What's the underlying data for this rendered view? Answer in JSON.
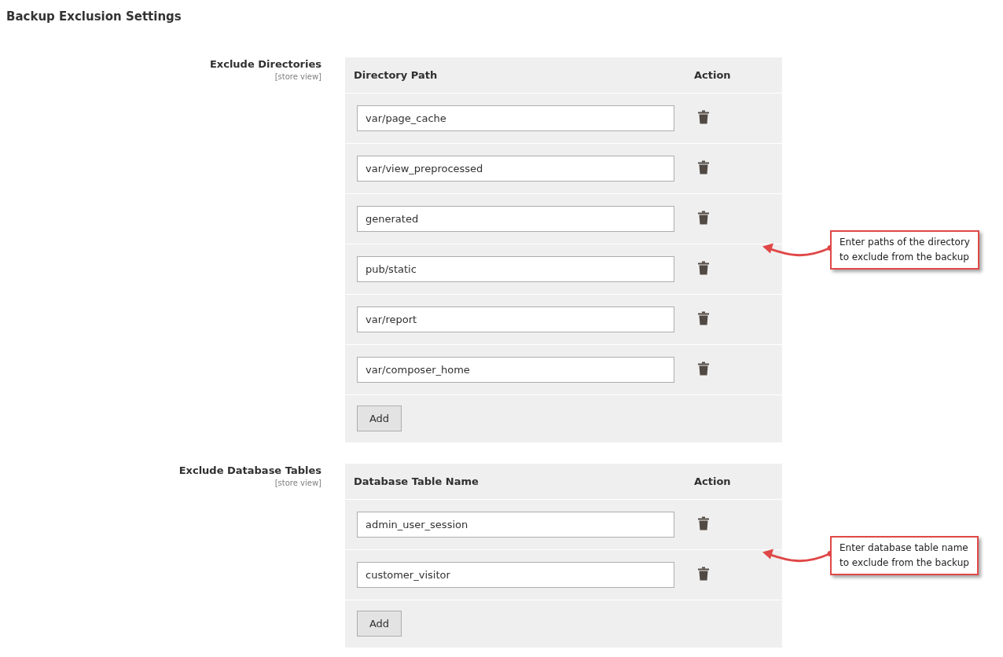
{
  "title": "Backup Exclusion Settings",
  "sections": [
    {
      "label": "Exclude Directories",
      "scope": "[store view]",
      "columns": [
        "Directory Path",
        "Action"
      ],
      "rows": [
        {
          "value": "var/page_cache"
        },
        {
          "value": "var/view_preprocessed"
        },
        {
          "value": "generated"
        },
        {
          "value": "pub/static"
        },
        {
          "value": "var/report"
        },
        {
          "value": "var/composer_home"
        }
      ],
      "add_button": "Add",
      "callout": [
        "Enter paths of the directory",
        "to exclude from the backup"
      ]
    },
    {
      "label": "Exclude Database Tables",
      "scope": "[store view]",
      "columns": [
        "Database Table Name",
        "Action"
      ],
      "rows": [
        {
          "value": "admin_user_session"
        },
        {
          "value": "customer_visitor"
        }
      ],
      "add_button": "Add",
      "callout": [
        "Enter database table name",
        "to exclude from the backup"
      ]
    }
  ]
}
